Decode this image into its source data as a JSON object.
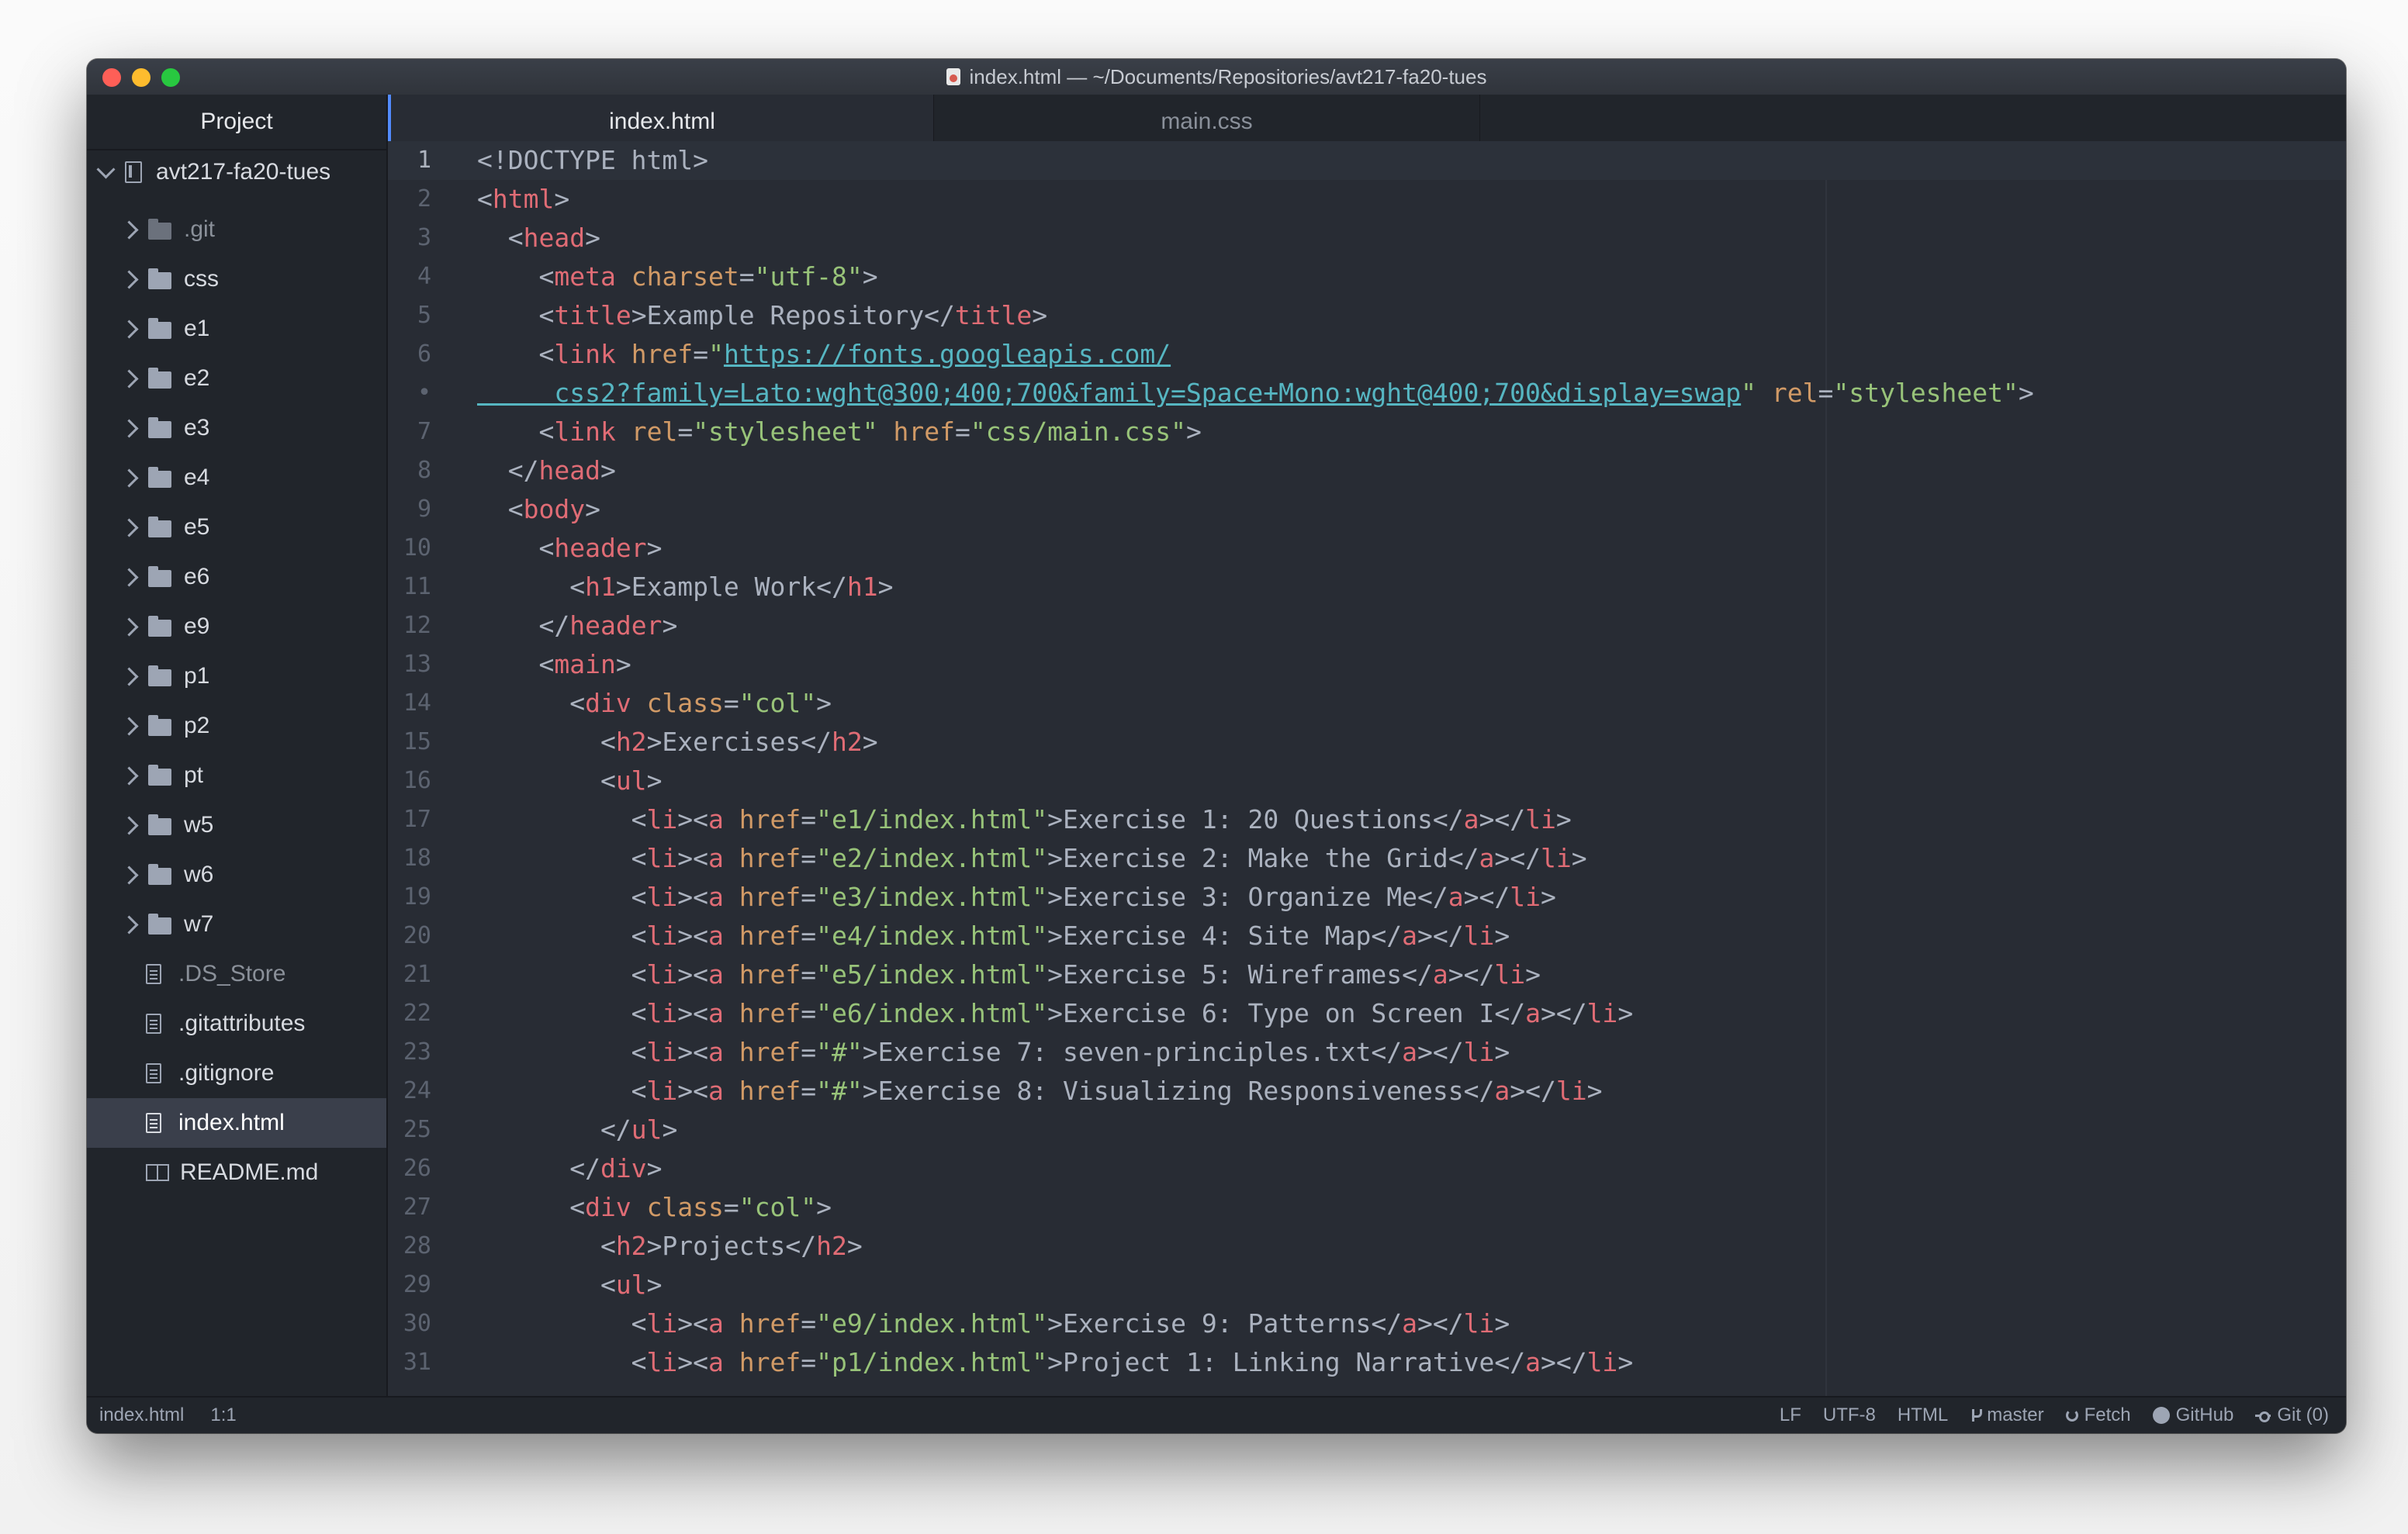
{
  "window": {
    "title": "index.html — ~/Documents/Repositories/avt217-fa20-tues"
  },
  "sidebar": {
    "header": "Project",
    "root": "avt217-fa20-tues",
    "items": [
      {
        "label": ".git",
        "type": "folder",
        "dim": true
      },
      {
        "label": "css",
        "type": "folder"
      },
      {
        "label": "e1",
        "type": "folder"
      },
      {
        "label": "e2",
        "type": "folder"
      },
      {
        "label": "e3",
        "type": "folder"
      },
      {
        "label": "e4",
        "type": "folder"
      },
      {
        "label": "e5",
        "type": "folder"
      },
      {
        "label": "e6",
        "type": "folder"
      },
      {
        "label": "e9",
        "type": "folder"
      },
      {
        "label": "p1",
        "type": "folder"
      },
      {
        "label": "p2",
        "type": "folder"
      },
      {
        "label": "pt",
        "type": "folder"
      },
      {
        "label": "w5",
        "type": "folder"
      },
      {
        "label": "w6",
        "type": "folder"
      },
      {
        "label": "w7",
        "type": "folder"
      },
      {
        "label": ".DS_Store",
        "type": "file",
        "dim": true
      },
      {
        "label": ".gitattributes",
        "type": "file"
      },
      {
        "label": ".gitignore",
        "type": "file"
      },
      {
        "label": "index.html",
        "type": "file",
        "selected": true
      },
      {
        "label": "README.md",
        "type": "book"
      }
    ]
  },
  "tabs": [
    {
      "label": "index.html",
      "active": true
    },
    {
      "label": "main.css"
    }
  ],
  "editor": {
    "lines": [
      {
        "n": "1",
        "tokens": [
          [
            "p",
            "<!DOCTYPE html>"
          ]
        ]
      },
      {
        "n": "2",
        "tokens": [
          [
            "p",
            "<"
          ],
          [
            "tg",
            "html"
          ],
          [
            "p",
            ">"
          ]
        ]
      },
      {
        "n": "3",
        "tokens": [
          [
            "p",
            "  <"
          ],
          [
            "tg",
            "head"
          ],
          [
            "p",
            ">"
          ]
        ]
      },
      {
        "n": "4",
        "tokens": [
          [
            "p",
            "    <"
          ],
          [
            "tg",
            "meta"
          ],
          [
            "p",
            " "
          ],
          [
            "at",
            "charset"
          ],
          [
            "p",
            "="
          ],
          [
            "s",
            "\"utf-8\""
          ],
          [
            "p",
            ">"
          ]
        ]
      },
      {
        "n": "5",
        "tokens": [
          [
            "p",
            "    <"
          ],
          [
            "tg",
            "title"
          ],
          [
            "p",
            ">Example Repository</"
          ],
          [
            "tg",
            "title"
          ],
          [
            "p",
            ">"
          ]
        ]
      },
      {
        "n": "6",
        "tokens": [
          [
            "p",
            "    <"
          ],
          [
            "tg",
            "link"
          ],
          [
            "p",
            " "
          ],
          [
            "at",
            "href"
          ],
          [
            "p",
            "="
          ],
          [
            "s",
            "\""
          ],
          [
            "u",
            "https://fonts.googleapis.com/"
          ]
        ]
      },
      {
        "n": "•",
        "tokens": [
          [
            "u",
            "     css2?family=Lato:wght@300;400;700&family=Space+Mono:wght@400;700&display=swap"
          ],
          [
            "s",
            "\""
          ],
          [
            "p",
            " "
          ],
          [
            "at",
            "rel"
          ],
          [
            "p",
            "="
          ],
          [
            "s",
            "\"stylesheet\""
          ],
          [
            "p",
            ">"
          ]
        ]
      },
      {
        "n": "7",
        "tokens": [
          [
            "p",
            "    <"
          ],
          [
            "tg",
            "link"
          ],
          [
            "p",
            " "
          ],
          [
            "at",
            "rel"
          ],
          [
            "p",
            "="
          ],
          [
            "s",
            "\"stylesheet\""
          ],
          [
            "p",
            " "
          ],
          [
            "at",
            "href"
          ],
          [
            "p",
            "="
          ],
          [
            "s",
            "\"css/main.css\""
          ],
          [
            "p",
            ">"
          ]
        ]
      },
      {
        "n": "8",
        "tokens": [
          [
            "p",
            "  </"
          ],
          [
            "tg",
            "head"
          ],
          [
            "p",
            ">"
          ]
        ]
      },
      {
        "n": "9",
        "tokens": [
          [
            "p",
            "  <"
          ],
          [
            "tg",
            "body"
          ],
          [
            "p",
            ">"
          ]
        ]
      },
      {
        "n": "10",
        "tokens": [
          [
            "p",
            "    <"
          ],
          [
            "tg",
            "header"
          ],
          [
            "p",
            ">"
          ]
        ]
      },
      {
        "n": "11",
        "tokens": [
          [
            "p",
            "      <"
          ],
          [
            "tg",
            "h1"
          ],
          [
            "p",
            ">Example Work</"
          ],
          [
            "tg",
            "h1"
          ],
          [
            "p",
            ">"
          ]
        ]
      },
      {
        "n": "12",
        "tokens": [
          [
            "p",
            "    </"
          ],
          [
            "tg",
            "header"
          ],
          [
            "p",
            ">"
          ]
        ]
      },
      {
        "n": "13",
        "tokens": [
          [
            "p",
            "    <"
          ],
          [
            "tg",
            "main"
          ],
          [
            "p",
            ">"
          ]
        ]
      },
      {
        "n": "14",
        "tokens": [
          [
            "p",
            "      <"
          ],
          [
            "tg",
            "div"
          ],
          [
            "p",
            " "
          ],
          [
            "at",
            "class"
          ],
          [
            "p",
            "="
          ],
          [
            "s",
            "\"col\""
          ],
          [
            "p",
            ">"
          ]
        ]
      },
      {
        "n": "15",
        "tokens": [
          [
            "p",
            "        <"
          ],
          [
            "tg",
            "h2"
          ],
          [
            "p",
            ">Exercises</"
          ],
          [
            "tg",
            "h2"
          ],
          [
            "p",
            ">"
          ]
        ]
      },
      {
        "n": "16",
        "tokens": [
          [
            "p",
            "        <"
          ],
          [
            "tg",
            "ul"
          ],
          [
            "p",
            ">"
          ]
        ]
      },
      {
        "n": "17",
        "tokens": [
          [
            "p",
            "          <"
          ],
          [
            "tg",
            "li"
          ],
          [
            "p",
            "><"
          ],
          [
            "tg",
            "a"
          ],
          [
            "p",
            " "
          ],
          [
            "at",
            "href"
          ],
          [
            "p",
            "="
          ],
          [
            "s",
            "\"e1/index.html\""
          ],
          [
            "p",
            ">Exercise 1: 20 Questions</"
          ],
          [
            "tg",
            "a"
          ],
          [
            "p",
            "></"
          ],
          [
            "tg",
            "li"
          ],
          [
            "p",
            ">"
          ]
        ]
      },
      {
        "n": "18",
        "tokens": [
          [
            "p",
            "          <"
          ],
          [
            "tg",
            "li"
          ],
          [
            "p",
            "><"
          ],
          [
            "tg",
            "a"
          ],
          [
            "p",
            " "
          ],
          [
            "at",
            "href"
          ],
          [
            "p",
            "="
          ],
          [
            "s",
            "\"e2/index.html\""
          ],
          [
            "p",
            ">Exercise 2: Make the Grid</"
          ],
          [
            "tg",
            "a"
          ],
          [
            "p",
            "></"
          ],
          [
            "tg",
            "li"
          ],
          [
            "p",
            ">"
          ]
        ]
      },
      {
        "n": "19",
        "tokens": [
          [
            "p",
            "          <"
          ],
          [
            "tg",
            "li"
          ],
          [
            "p",
            "><"
          ],
          [
            "tg",
            "a"
          ],
          [
            "p",
            " "
          ],
          [
            "at",
            "href"
          ],
          [
            "p",
            "="
          ],
          [
            "s",
            "\"e3/index.html\""
          ],
          [
            "p",
            ">Exercise 3: Organize Me</"
          ],
          [
            "tg",
            "a"
          ],
          [
            "p",
            "></"
          ],
          [
            "tg",
            "li"
          ],
          [
            "p",
            ">"
          ]
        ]
      },
      {
        "n": "20",
        "tokens": [
          [
            "p",
            "          <"
          ],
          [
            "tg",
            "li"
          ],
          [
            "p",
            "><"
          ],
          [
            "tg",
            "a"
          ],
          [
            "p",
            " "
          ],
          [
            "at",
            "href"
          ],
          [
            "p",
            "="
          ],
          [
            "s",
            "\"e4/index.html\""
          ],
          [
            "p",
            ">Exercise 4: Site Map</"
          ],
          [
            "tg",
            "a"
          ],
          [
            "p",
            "></"
          ],
          [
            "tg",
            "li"
          ],
          [
            "p",
            ">"
          ]
        ]
      },
      {
        "n": "21",
        "tokens": [
          [
            "p",
            "          <"
          ],
          [
            "tg",
            "li"
          ],
          [
            "p",
            "><"
          ],
          [
            "tg",
            "a"
          ],
          [
            "p",
            " "
          ],
          [
            "at",
            "href"
          ],
          [
            "p",
            "="
          ],
          [
            "s",
            "\"e5/index.html\""
          ],
          [
            "p",
            ">Exercise 5: Wireframes</"
          ],
          [
            "tg",
            "a"
          ],
          [
            "p",
            "></"
          ],
          [
            "tg",
            "li"
          ],
          [
            "p",
            ">"
          ]
        ]
      },
      {
        "n": "22",
        "tokens": [
          [
            "p",
            "          <"
          ],
          [
            "tg",
            "li"
          ],
          [
            "p",
            "><"
          ],
          [
            "tg",
            "a"
          ],
          [
            "p",
            " "
          ],
          [
            "at",
            "href"
          ],
          [
            "p",
            "="
          ],
          [
            "s",
            "\"e6/index.html\""
          ],
          [
            "p",
            ">Exercise 6: Type on Screen I</"
          ],
          [
            "tg",
            "a"
          ],
          [
            "p",
            "></"
          ],
          [
            "tg",
            "li"
          ],
          [
            "p",
            ">"
          ]
        ]
      },
      {
        "n": "23",
        "tokens": [
          [
            "p",
            "          <"
          ],
          [
            "tg",
            "li"
          ],
          [
            "p",
            "><"
          ],
          [
            "tg",
            "a"
          ],
          [
            "p",
            " "
          ],
          [
            "at",
            "href"
          ],
          [
            "p",
            "="
          ],
          [
            "s",
            "\"#\""
          ],
          [
            "p",
            ">Exercise 7: seven-principles.txt</"
          ],
          [
            "tg",
            "a"
          ],
          [
            "p",
            "></"
          ],
          [
            "tg",
            "li"
          ],
          [
            "p",
            ">"
          ]
        ]
      },
      {
        "n": "24",
        "tokens": [
          [
            "p",
            "          <"
          ],
          [
            "tg",
            "li"
          ],
          [
            "p",
            "><"
          ],
          [
            "tg",
            "a"
          ],
          [
            "p",
            " "
          ],
          [
            "at",
            "href"
          ],
          [
            "p",
            "="
          ],
          [
            "s",
            "\"#\""
          ],
          [
            "p",
            ">Exercise 8: Visualizing Responsiveness</"
          ],
          [
            "tg",
            "a"
          ],
          [
            "p",
            "></"
          ],
          [
            "tg",
            "li"
          ],
          [
            "p",
            ">"
          ]
        ]
      },
      {
        "n": "25",
        "tokens": [
          [
            "p",
            "        </"
          ],
          [
            "tg",
            "ul"
          ],
          [
            "p",
            ">"
          ]
        ]
      },
      {
        "n": "26",
        "tokens": [
          [
            "p",
            "      </"
          ],
          [
            "tg",
            "div"
          ],
          [
            "p",
            ">"
          ]
        ]
      },
      {
        "n": "27",
        "tokens": [
          [
            "p",
            "      <"
          ],
          [
            "tg",
            "div"
          ],
          [
            "p",
            " "
          ],
          [
            "at",
            "class"
          ],
          [
            "p",
            "="
          ],
          [
            "s",
            "\"col\""
          ],
          [
            "p",
            ">"
          ]
        ]
      },
      {
        "n": "28",
        "tokens": [
          [
            "p",
            "        <"
          ],
          [
            "tg",
            "h2"
          ],
          [
            "p",
            ">Projects</"
          ],
          [
            "tg",
            "h2"
          ],
          [
            "p",
            ">"
          ]
        ]
      },
      {
        "n": "29",
        "tokens": [
          [
            "p",
            "        <"
          ],
          [
            "tg",
            "ul"
          ],
          [
            "p",
            ">"
          ]
        ]
      },
      {
        "n": "30",
        "tokens": [
          [
            "p",
            "          <"
          ],
          [
            "tg",
            "li"
          ],
          [
            "p",
            "><"
          ],
          [
            "tg",
            "a"
          ],
          [
            "p",
            " "
          ],
          [
            "at",
            "href"
          ],
          [
            "p",
            "="
          ],
          [
            "s",
            "\"e9/index.html\""
          ],
          [
            "p",
            ">Exercise 9: Patterns</"
          ],
          [
            "tg",
            "a"
          ],
          [
            "p",
            "></"
          ],
          [
            "tg",
            "li"
          ],
          [
            "p",
            ">"
          ]
        ]
      },
      {
        "n": "31",
        "tokens": [
          [
            "p",
            "          <"
          ],
          [
            "tg",
            "li"
          ],
          [
            "p",
            "><"
          ],
          [
            "tg",
            "a"
          ],
          [
            "p",
            " "
          ],
          [
            "at",
            "href"
          ],
          [
            "p",
            "="
          ],
          [
            "s",
            "\"p1/index.html\""
          ],
          [
            "p",
            ">Project 1: Linking Narrative</"
          ],
          [
            "tg",
            "a"
          ],
          [
            "p",
            "></"
          ],
          [
            "tg",
            "li"
          ],
          [
            "p",
            ">"
          ]
        ]
      }
    ]
  },
  "statusbar": {
    "file": "index.html",
    "cursor": "1:1",
    "line_ending": "LF",
    "encoding": "UTF-8",
    "grammar": "HTML",
    "branch": "master",
    "fetch": "Fetch",
    "github": "GitHub",
    "git": "Git (0)"
  },
  "colors": {
    "tag": "#e06c75",
    "attribute": "#d19a66",
    "string": "#98c379",
    "url": "#56b6c2",
    "text": "#abb2bf",
    "accent": "#528bff"
  }
}
